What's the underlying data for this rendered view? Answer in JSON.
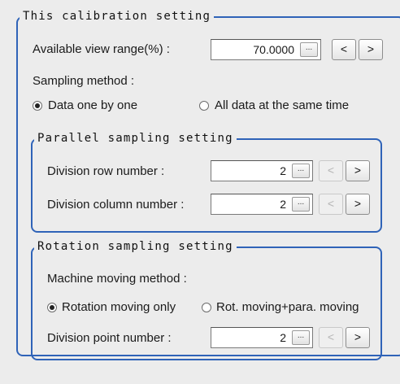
{
  "calibration": {
    "title": "This calibration setting",
    "view_range_label": "Available view range(%) :",
    "view_range_value": "70.0000",
    "sampling_method_label": "Sampling method :",
    "sampling_options": [
      "Data one by one",
      "All data at the same time"
    ],
    "sampling_selected": "Data one by one"
  },
  "parallel": {
    "title": "Parallel sampling setting",
    "row_label": "Division row number :",
    "row_value": "2",
    "col_label": "Division column number :",
    "col_value": "2"
  },
  "rotation": {
    "title": "Rotation sampling setting",
    "moving_method_label": "Machine moving method :",
    "moving_options": [
      "Rotation moving only",
      "Rot. moving+para. moving"
    ],
    "moving_selected": "Rotation moving only",
    "point_label": "Division point number :",
    "point_value": "2"
  },
  "buttons": {
    "ellipsis": "...",
    "decrement": "<",
    "increment": ">"
  }
}
